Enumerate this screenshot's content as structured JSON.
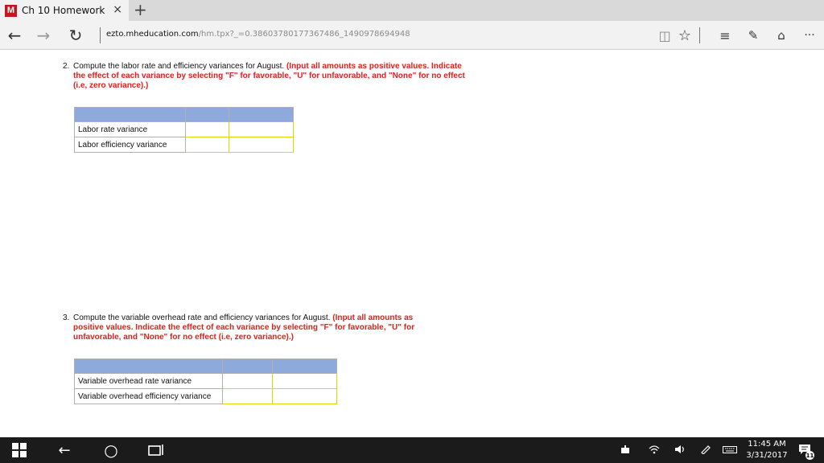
{
  "browser": {
    "tab": {
      "favicon": "M",
      "title": "Ch 10 Homework",
      "close": "×",
      "favicon_color": "#c4161c"
    },
    "new_tab": "+",
    "nav": {
      "back": "←",
      "forward": "→",
      "refresh": "↻"
    },
    "address": {
      "host": "ezto.mheducation.com",
      "path": "/hm.tpx?_=0.38603780177367486_1490978694948"
    },
    "toolbar": {
      "reading_view": "◫",
      "favorite": "☆",
      "hub": "≡",
      "web_note": "✎",
      "share": "⌂",
      "more": "···"
    }
  },
  "questions": [
    {
      "number": "2.",
      "prompt": "Compute the labor rate and efficiency variances for August.",
      "instructions": "(Input all amounts as positive values. Indicate the effect of each variance by selecting \"F\" for favorable, \"U\" for unfavorable, and \"None\" for no effect (i.e, zero variance).)",
      "rows": [
        {
          "label": "Labor rate variance",
          "amount": "",
          "effect": ""
        },
        {
          "label": "Labor efficiency variance",
          "amount": "",
          "effect": ""
        }
      ]
    },
    {
      "number": "3.",
      "prompt": "Compute the variable overhead rate and efficiency variances for August.",
      "instructions": "(Input all amounts as positive values. Indicate the effect of each variance by selecting \"F\" for favorable, \"U\" for unfavorable, and \"None\" for no effect (i.e, zero variance).)",
      "rows": [
        {
          "label": "Variable overhead rate variance",
          "amount": "",
          "effect": ""
        },
        {
          "label": "Variable overhead efficiency variance",
          "amount": "",
          "effect": ""
        }
      ]
    }
  ],
  "colors": {
    "instruction_red": "#e1201c",
    "table_header_blue": "#8ea9db",
    "input_border_yellow": "#e0d800"
  },
  "taskbar": {
    "start": "windows-logo-icon",
    "back": "←",
    "cortana": "○",
    "task_view": "task-view-icon",
    "clock": {
      "time": "11:45 AM",
      "date": "3/31/2017"
    },
    "notifications_count": "11"
  }
}
